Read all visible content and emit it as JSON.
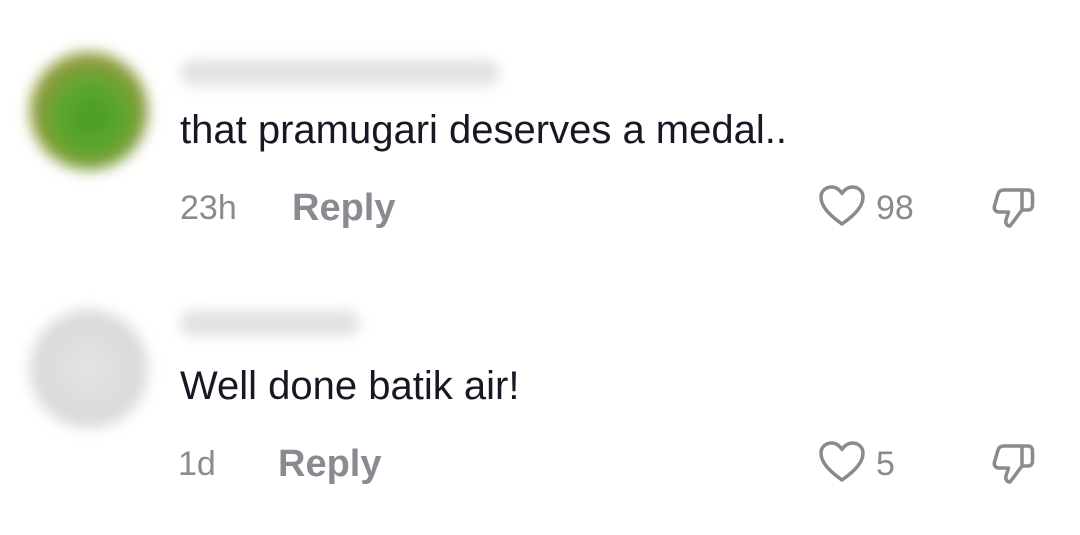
{
  "comments": [
    {
      "text": "that pramugari deserves a medal..",
      "time": "23h",
      "reply_label": "Reply",
      "likes": "98",
      "icons": {
        "like": "heart-icon",
        "dislike": "thumbs-down-icon"
      }
    },
    {
      "text": "Well done batik air!",
      "time": "1d",
      "reply_label": "Reply",
      "likes": "5",
      "icons": {
        "like": "heart-icon",
        "dislike": "thumbs-down-icon"
      }
    }
  ],
  "colors": {
    "text": "#161823",
    "secondary": "#8a8b91"
  }
}
